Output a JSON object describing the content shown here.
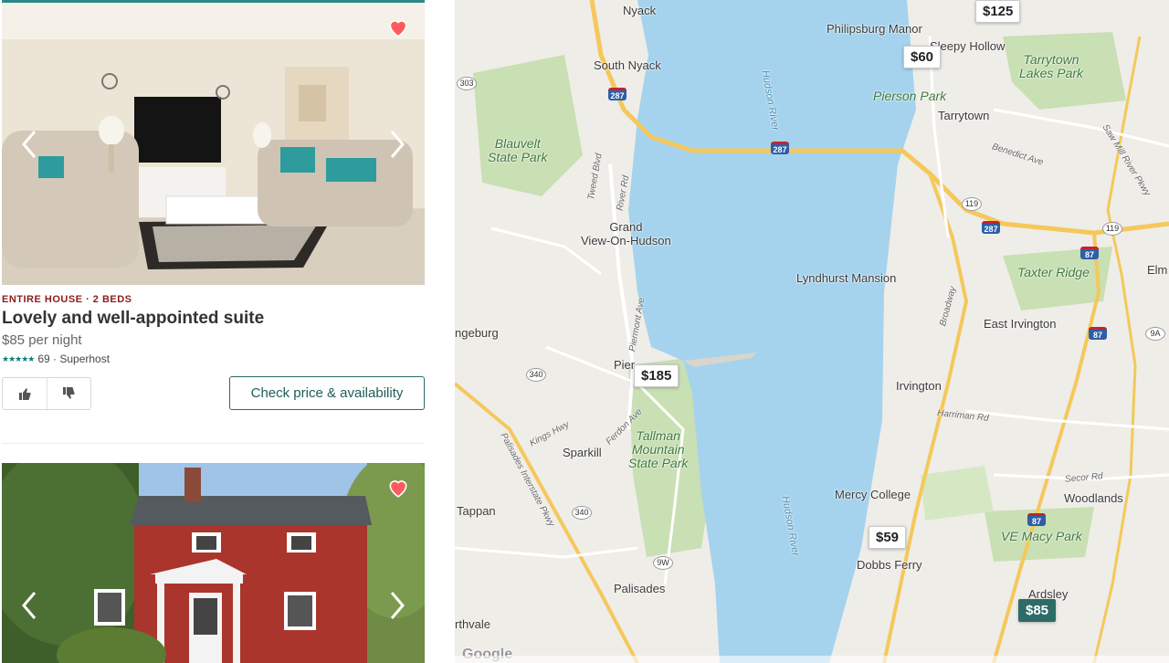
{
  "listings": [
    {
      "type": "ENTIRE HOUSE · 2 BEDS",
      "title": "Lovely and well-appointed suite",
      "price": "$85",
      "per": "per night",
      "stars": "★★★★★",
      "reviews": "69 · Superhost",
      "cta": "Check price & availability",
      "favorited": true
    },
    {
      "favorited": true
    }
  ],
  "map": {
    "labels": {
      "nyack": "Nyack",
      "south_nyack": "South Nyack",
      "blauvelt": "Blauvelt\nState Park",
      "grand_view": "Grand\nView-On-Hudson",
      "orangeburg": "ngeburg",
      "piermont": "Pier",
      "sparkill": "Sparkill",
      "tallman": "Tallman\nMountain\nState Park",
      "tappan": "Tappan",
      "palisades": "Palisades",
      "northvale": "rthvale",
      "philipsburg": "Philipsburg Manor",
      "sleepy_hollow": "Sleepy Hollow",
      "tarrytown_lakes": "Tarrytown\nLakes Park",
      "pierson": "Pierson Park",
      "tarrytown": "Tarrytown",
      "lyndhurst": "Lyndhurst Mansion",
      "taxter": "Taxter Ridge",
      "east_irvington": "East Irvington",
      "irvington": "Irvington",
      "mercy": "Mercy College",
      "woodlands": "Woodlands",
      "ve_macy": "VE Macy Park",
      "dobbs": "Dobbs Ferry",
      "ardsley": "Ardsley",
      "elm": "Elm",
      "hudson1": "Hudson River",
      "hudson2": "Hudson River",
      "benedict": "Benedict Ave",
      "broadway": "Broadway",
      "harriman": "Harriman Rd",
      "secor": "Secor Rd",
      "palisades_pkwy": "Palisades Interstate Pkwy",
      "kings_hwy": "Kings Hwy",
      "ferdon": "Ferdon Ave",
      "river_rd": "River Rd",
      "piermont_ave": "Piermont Ave",
      "tweed": "Tweed Blvd",
      "saw_mill": "Saw Mill River Pkwy",
      "google": "Google"
    },
    "pins": [
      "$125",
      "$60",
      "$185",
      "$59",
      "$85"
    ],
    "shields": [
      "287",
      "287",
      "287",
      "87",
      "87",
      "87"
    ],
    "ovals": [
      "303",
      "340",
      "340",
      "9W",
      "119",
      "119",
      "9A"
    ]
  },
  "colors": {
    "accent": "#2d6b68",
    "heart": "#ff5a5f",
    "water": "#a5d3ee",
    "park": "#c9dfb4",
    "highway": "#f9d36b"
  }
}
